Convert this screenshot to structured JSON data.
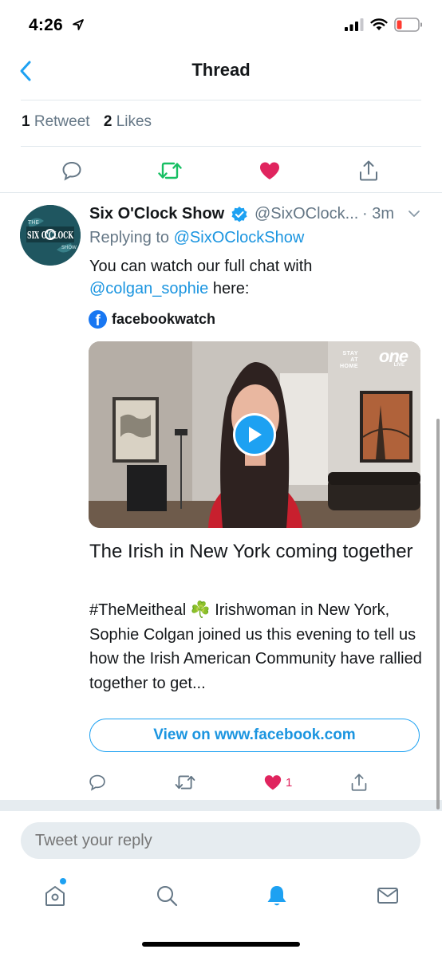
{
  "status_bar": {
    "time": "4:26"
  },
  "nav": {
    "title": "Thread"
  },
  "engagement": {
    "retweet_count": "1",
    "retweet_label": "Retweet",
    "like_count": "2",
    "like_label": "Likes"
  },
  "tweet": {
    "author_name": "Six O'Clock Show",
    "handle": "@SixOClock...",
    "time": "· 3m",
    "replying_prefix": "Replying to",
    "replying_to": "@SixOClockShow",
    "text_before": "You can watch our full chat with",
    "mention": "@colgan_sophie",
    "text_after": " here:",
    "source_label": "facebookwatch",
    "video_brand_top": "STAY AT",
    "video_brand_bottom": "HOME",
    "video_brand_logo": "one",
    "video_brand_live": "LIVE",
    "card_title": "The Irish in New York coming together",
    "card_description": "#TheMeitheal ☘️ Irishwoman in New York, Sophie Colgan joined us this evening to tell us how the Irish American Community have rallied together to get...",
    "view_button": "View on www.facebook.com",
    "like_count": "1",
    "avatar_text_top": "THE",
    "avatar_text_main": "SIX O'CLOCK",
    "avatar_text_bottom": "SHOW"
  },
  "reply": {
    "placeholder": "Tweet your reply"
  },
  "colors": {
    "accent": "#1da1f2",
    "link": "#1b95e0",
    "like": "#e0245e",
    "retweet": "#17bf63",
    "secondary_text": "#657786",
    "facebook": "#1877f2"
  },
  "icons": {
    "nav": "chevron-left-icon",
    "main_actions": [
      "reply-icon",
      "retweet-icon",
      "heart-filled-icon",
      "share-icon"
    ],
    "tabs": [
      "home-icon",
      "search-icon",
      "notifications-bell-icon",
      "messages-envelope-icon"
    ]
  }
}
